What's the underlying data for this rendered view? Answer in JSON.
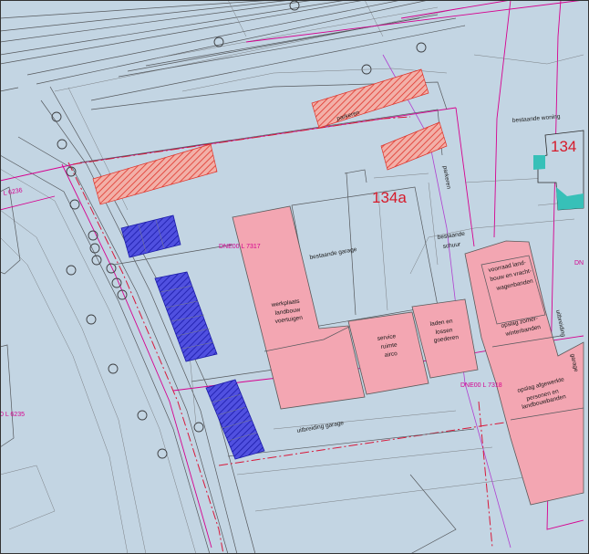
{
  "colors": {
    "background": "#c3d5e3",
    "new_building": "#f3a6b2",
    "parking_red": "#e34a3c",
    "parking_blue": "#3a3ad6",
    "cadastral_line": "#d6008f",
    "existing_house": "#2fb8b0"
  },
  "labels": {
    "building_number_main": "134a",
    "building_number_existing": "134",
    "parcel_7317": "DNE00 L 7317",
    "parcel_7318": "DNE00 L 7318",
    "parcel_6235": "0 L 6235",
    "parcel_6236": "L 6236",
    "parcel_edge": "DN",
    "parkeren_1": "parkeren",
    "parkeren_2": "parkeren",
    "bestaande_woning": "bestaande woning",
    "bestaande_garage": "bestaande garage",
    "bestaande_schuur_1": "bestaande",
    "bestaande_schuur_2": "schuur",
    "werkplaats_1": "werkplaats",
    "werkplaats_2": "landbouw",
    "werkplaats_3": "voertuigen",
    "service_1": "service",
    "service_2": "ruimte",
    "service_3": "airco",
    "laden_1": "laden en",
    "laden_2": "lossen",
    "laden_3": "goederen",
    "voorraad_1": "voorraad land-",
    "voorraad_2": "bouw en vracht-",
    "voorraad_3": "wagenbanden",
    "opslag_zomer_1": "opslag zomer-",
    "opslag_zomer_2": "winterbanden",
    "opslag_afgewerkte_1": "opslag afgewerkte",
    "opslag_afgewerkte_2": "personen en",
    "opslag_afgewerkte_3": "landbouwbanden",
    "uitbreiding_garage": "uitbreiding garage",
    "uitbreiding_right": "uitbreiding",
    "garage_right": "garage"
  }
}
